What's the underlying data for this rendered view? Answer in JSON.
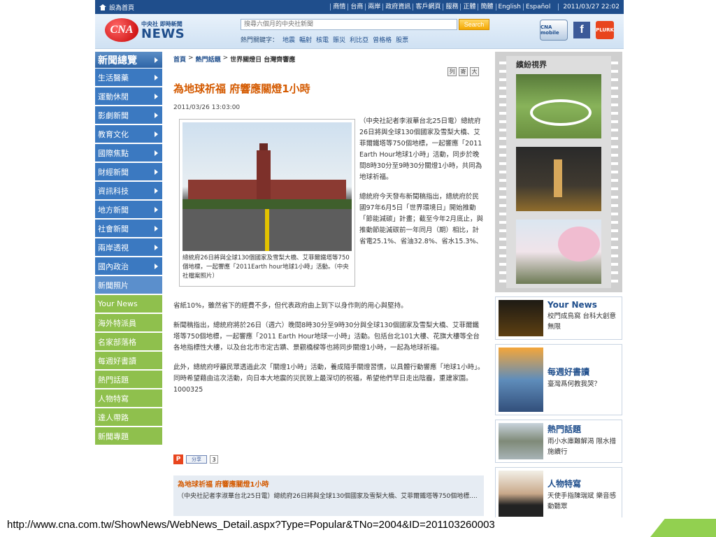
{
  "topbar": {
    "home_label": "設為首頁",
    "links": [
      "商情",
      "台商",
      "兩岸",
      "政府資訊",
      "客戶網頁",
      "服務",
      "正體",
      "簡體",
      "English",
      "Español"
    ],
    "datetime": "2011/03/27 22:02"
  },
  "header": {
    "logo_small": "中央社 即時新聞",
    "logo_mark": "CNA",
    "logo_big": "NEWS",
    "search_placeholder": "搜尋六個月的中央社新聞",
    "search_button": "Search",
    "hot_label": "熱門關鍵字：",
    "hot_keywords": [
      "地震",
      "輻射",
      "核電",
      "賑災",
      "利比亞",
      "曾格格",
      "股票"
    ],
    "mobile_label": "CNA mobile",
    "plurk_label": "PLURK"
  },
  "leftnav": {
    "head": "新聞總覽",
    "items": [
      "生活醫藥",
      "運動休閒",
      "影劇新聞",
      "教育文化",
      "國際焦點",
      "財經新聞",
      "資訊科技",
      "地方新聞",
      "社會新聞",
      "兩岸透視",
      "國內政治"
    ],
    "plain_items": [
      "新聞照片"
    ],
    "green_items": [
      "Your News",
      "海外特派員",
      "名家部落格",
      "每週好書讀",
      "熱門話題",
      "人物特寫",
      "達人帶路",
      "新聞專題"
    ]
  },
  "breadcrumb": {
    "home": "首頁",
    "section": "熱門話題",
    "current": "世界關燈日 台灣齊響應"
  },
  "tools": [
    "列",
    "寄",
    "大"
  ],
  "article": {
    "title": "為地球祈福 府響應關燈1小時",
    "date": "2011/03/26 13:03:00",
    "caption": "總統府26日將與全球130個國家及雪梨大橋、艾菲爾鐵塔等750個地標，一起響應「2011Earth hour地球1小時」活動。（中央社檔案照片）",
    "lead": "（中央社記者李淑華台北25日電）總統府26日將與全球130個國家及雪梨大橋、艾菲爾鐵塔等750個地標，一起響應「2011 Earth Hour地球1小時」活動，同步於晚間8時30分至9時30分關燈1小時，共同為地球祈福。",
    "para2": "總統府今天發布新聞稿指出，總統府於民國97年6月5日「世界環境日」開始推動「節能減碳」計畫；截至今年2月底止，與推動節能減碳前一年同月（期）相比，計省電25.1%、省油32.8%、省水15.3%、",
    "para2_cont": "省紙10%，雖然省下的經費不多，但代表政府由上到下以身作則的用心與堅持。",
    "para3": "新聞稿指出，總統府將於26日（週六）晚間8時30分至9時30分與全球130個國家及雪梨大橋、艾菲爾鐵塔等750個地標，一起響應「2011 Earth Hour地球一小時」活動。包括台北101大樓、花旗大樓等全台各地指標性大樓，以及台北市市定古蹟、景觀橋樑等也將同步關燈1小時，一起為地球祈福。",
    "para4": "此外，總統府呼籲民眾透過此次「關燈1小時」活動，養成隨手關燈習慣，以具體行動響應「地球1小時」。同時希望藉由這次活動，向日本大地震的災民致上最深切的祝福，希望他們早日走出陰霾，重建家園。1000325"
  },
  "share": {
    "plurk": "P",
    "facebook": "分享",
    "count": "3"
  },
  "related": {
    "title": "為地球祈福 府響應關燈1小時",
    "body": "（中央社記者李淑華台北25日電）總統府26日將與全球130個國家及雪梨大橋、艾菲爾鐵塔等750個地標...."
  },
  "rightcol": {
    "gallery_title": "繽紛視界",
    "cards": [
      {
        "title": "Your News",
        "desc": "校門成鳥窩 台科大創意無限"
      },
      {
        "title": "每週好書讀",
        "desc": "臺灣爲何教我哭？"
      },
      {
        "title": "熱門話題",
        "desc": "雨小水庫難解渴 限水措施續行"
      },
      {
        "title": "人物特寫",
        "desc": "天使手指陳瑞斌 樂音感動聽眾"
      }
    ]
  },
  "footer_url": "http://www.cna.com.tw/ShowNews/WebNews_Detail.aspx?Type=Popular&TNo=2004&ID=201103260003"
}
